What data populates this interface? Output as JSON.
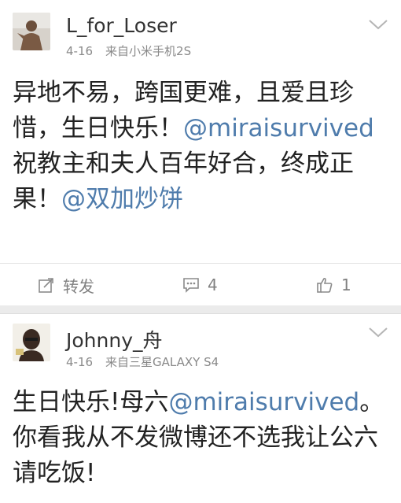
{
  "posts": [
    {
      "username": "L_for_Loser",
      "date": "4-16",
      "source": "来自小米手机2S",
      "text_1": "异地不易，跨国更难，且爱且珍惜，生日快乐！",
      "mention_1": "@miraisurvived",
      "text_2": " 祝教主和夫人百年好合，终成正果！",
      "mention_2": "@双加炒饼",
      "actions": {
        "repost_label": "转发",
        "comment_count": "4",
        "like_count": "1"
      }
    },
    {
      "username": "Johnny_舟",
      "date": "4-16",
      "source": "来自三星GALAXY S4",
      "text_1": "生日快乐!母六",
      "mention_1": "@miraisurvived",
      "text_2": "。你看我从不发微博还不选我让公六请吃饭!"
    }
  ],
  "colors": {
    "mention": "#4f7cac",
    "meta": "#8a8a8a",
    "background": "#ebebeb"
  },
  "icons": [
    "chevron-down-icon",
    "repost-icon",
    "comment-icon",
    "like-icon"
  ]
}
